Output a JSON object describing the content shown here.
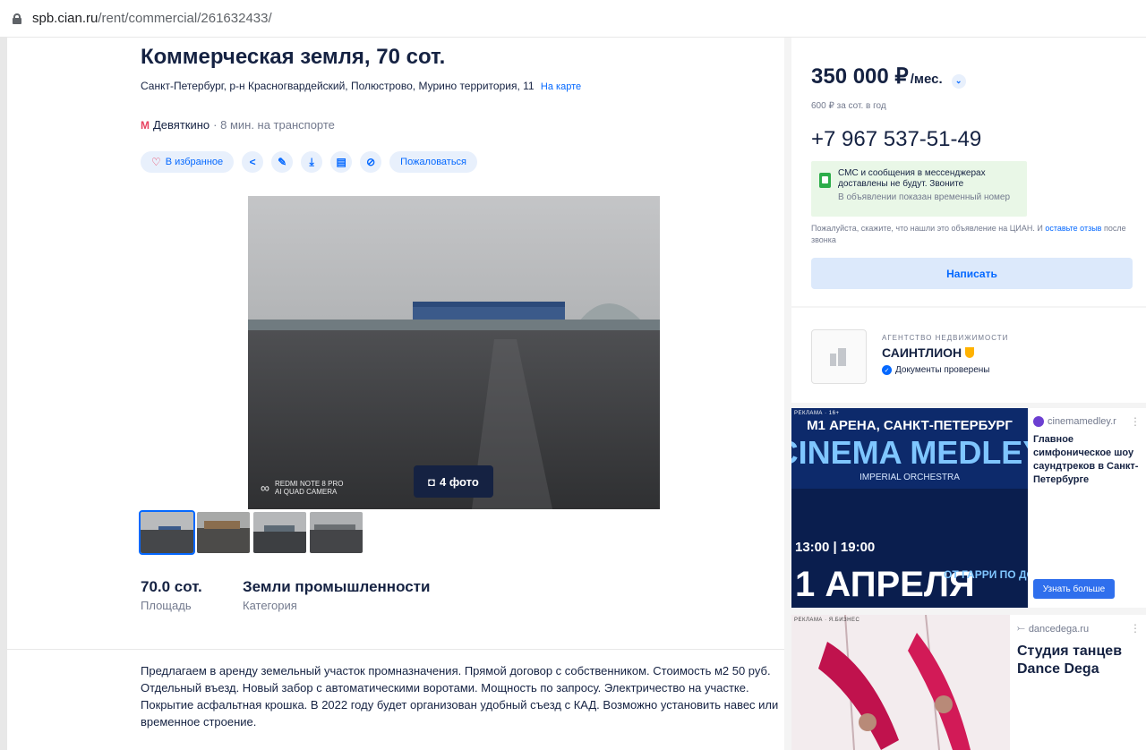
{
  "browser": {
    "url_domain": "spb.cian.ru",
    "url_path": "/rent/commercial/261632433/"
  },
  "listing": {
    "title": "Коммерческая земля, 70 сот.",
    "address": "Санкт-Петербург, р-н Красногвардейский, Полюстрово, Мурино территория, 11",
    "map_link": "На карте",
    "metro_icon": "metro-icon",
    "metro_station": "Девяткино",
    "metro_time": "· 8 мин. на транспорте",
    "actions": {
      "favorite": "В избранное",
      "complain": "Пожаловаться",
      "icons": [
        "share-icon",
        "edit-icon",
        "download-icon",
        "print-icon",
        "hide-icon"
      ]
    },
    "photo": {
      "count_label": "4 фото",
      "camera_model": "REDMI NOTE 8 PRO",
      "camera_ai": "AI QUAD CAMERA",
      "thumbnails": 4
    },
    "facts": [
      {
        "value": "70.0 сот.",
        "label": "Площадь"
      },
      {
        "value": "Земли промышленности",
        "label": "Категория"
      }
    ],
    "description": "Предлагаем в аренду земельный участок промназначения. Прямой договор с собственником. Стоимость м2 50 руб. Отдельный въезд. Новый забор с автоматическими воротами. Мощность по запросу. Электричество на участке. Покрытие асфальтная крошка. В 2022 году будет организован удобный съезд с КАД.  Возможно установить навес или временное строение."
  },
  "contact": {
    "price": "350 000 ₽",
    "price_unit": "/мес.",
    "price_per_unit": "600 ₽ за сот. в год",
    "phone": "+7 967 537-51-49",
    "sms_notice_1": "СМС и сообщения в мессенджерах",
    "sms_notice_2": "доставлены не будут. Звоните",
    "sms_notice_3": "В объявлении показан временный номер",
    "feedback_prefix": "Пожалуйста, скажите, что нашли это объявление на ЦИАН. И",
    "feedback_link": "оставьте отзыв",
    "feedback_suffix": "после звонка",
    "write_button": "Написать"
  },
  "agency": {
    "type": "АГЕНТСТВО НЕДВИЖИМОСТИ",
    "name": "САИНТЛИОН",
    "verified": "Документы проверены"
  },
  "ads": [
    {
      "label": "РЕКЛАМА · 16+",
      "source": "cinemamedley.r",
      "headline": "Главное симфоническое шоу саундтреков в Санкт-Петербурге",
      "button": "Узнать больше",
      "banner_venue": "М1 АРЕНА, САНКТ-ПЕТЕРБУРГ",
      "banner_title": "CINEMA MEDLEY",
      "banner_subtitle": "IMPERIAL ORCHESTRA",
      "banner_time": "13:00 | 19:00",
      "banner_date": "1 АПРЕЛЯ",
      "banner_tag": "ОТ ГАРРИ ПО ДО ИНТЕРС"
    },
    {
      "label": "РЕКЛАМА · Я.БИЗНЕС",
      "source": "dancedega.ru",
      "headline": "Студия танцев Dance Dega"
    }
  ],
  "colors": {
    "accent": "#0468ff",
    "text": "#152242",
    "muted": "#737a8e",
    "metro": "#e84260",
    "sms_bg": "#e9f7e7"
  }
}
